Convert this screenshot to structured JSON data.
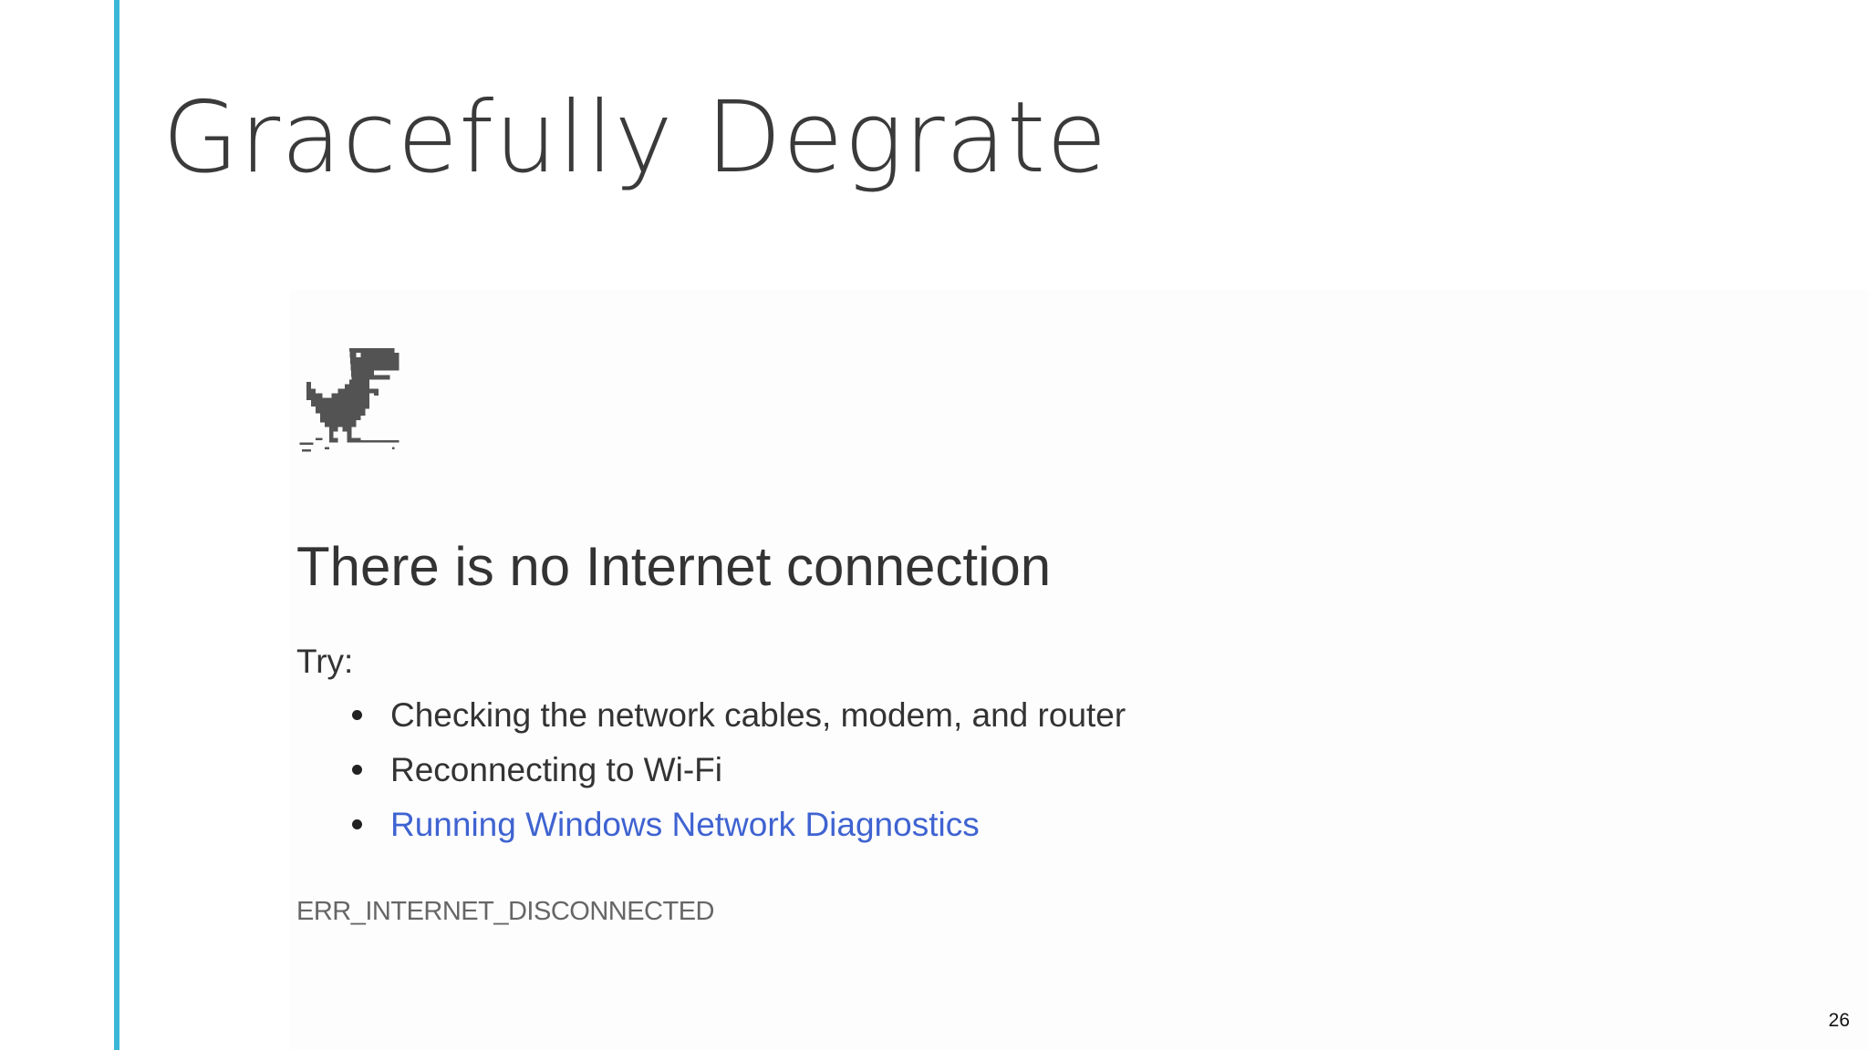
{
  "slide": {
    "title": "Gracefully Degrate",
    "page_number": "26",
    "accent_color": "#3bb6d6"
  },
  "error_page": {
    "icon": "dinosaur-icon",
    "title": "There is no Internet connection",
    "try_label": "Try:",
    "suggestions": [
      {
        "text": "Checking the network cables, modem, and router",
        "link": false
      },
      {
        "text": "Reconnecting to Wi-Fi",
        "link": false
      },
      {
        "text": "Running Windows Network Diagnostics",
        "link": true
      }
    ],
    "error_code": "ERR_INTERNET_DISCONNECTED",
    "link_color": "#3f63d1"
  }
}
